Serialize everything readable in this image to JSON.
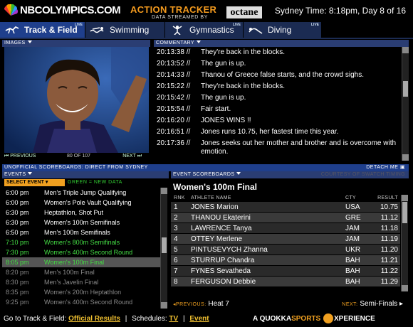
{
  "header": {
    "site": "NBCOLYMPICS.COM",
    "action_title": "ACTION TRACKER",
    "streamed": "DATA STREAMED BY",
    "octane": "octane",
    "sydney_time": "Sydney Time: 8:18pm, Day 8 of 16"
  },
  "tabs": [
    {
      "label": "Track & Field",
      "icon": "runner-icon",
      "active": true
    },
    {
      "label": "Swimming",
      "icon": "swimmer-icon",
      "active": false
    },
    {
      "label": "Gymnastics",
      "icon": "gymnast-icon",
      "active": false
    },
    {
      "label": "Diving",
      "icon": "diver-icon",
      "active": false
    }
  ],
  "live_badge": "LIVE",
  "images": {
    "header": "IMAGES",
    "prev": "PREVIOUS",
    "count": "80 OF 107",
    "next": "NEXT"
  },
  "commentary": {
    "header": "COMMENTARY",
    "entries": [
      {
        "time": "20:13:38 //",
        "text": "They're back in the blocks."
      },
      {
        "time": "20:13:52 //",
        "text": "The gun is up."
      },
      {
        "time": "20:14:33 //",
        "text": "Thanou of Greece false starts, and the crowd sighs."
      },
      {
        "time": "20:15:22 //",
        "text": "They're back in the blocks."
      },
      {
        "time": "20:15:42 //",
        "text": "The gun is up."
      },
      {
        "time": "20:15:54 //",
        "text": "Fair start."
      },
      {
        "time": "20:16:20 //",
        "text": "JONES WINS !!"
      },
      {
        "time": "20:16:51 //",
        "text": "Jones runs 10.75, her fastest time this year."
      },
      {
        "time": "20:17:36 //",
        "text": "Jones seeks out her mother and brother and is overcome with emotion."
      }
    ]
  },
  "scoreboard_bar": {
    "title": "UNOFFICIAL SCOREBOARDS: DIRECT FROM SYDNEY",
    "detach": "DETACH ME"
  },
  "events": {
    "header": "EVENTS",
    "select_label": "SELECT EVENT",
    "green_note": "GREEN = NEW DATA",
    "rows": [
      {
        "time": "6:00 pm",
        "name": "Men's Triple Jump Qualifying",
        "state": "done"
      },
      {
        "time": "6:00 pm",
        "name": "Women's Pole Vault Qualifying",
        "state": "done"
      },
      {
        "time": "6:30 pm",
        "name": "Heptathlon, Shot Put",
        "state": "done"
      },
      {
        "time": "6:30 pm",
        "name": "Women's 100m Semifinals",
        "state": "done"
      },
      {
        "time": "6:50 pm",
        "name": "Men's 100m Semifinals",
        "state": "done"
      },
      {
        "time": "7:10 pm",
        "name": "Women's 800m Semifinals",
        "state": "live"
      },
      {
        "time": "7:30 pm",
        "name": "Women's 400m Second Round",
        "state": "live"
      },
      {
        "time": "8:05 pm",
        "name": "Women's 100m Final",
        "state": "sel"
      },
      {
        "time": "8:20 pm",
        "name": "Men's 100m Final",
        "state": "future"
      },
      {
        "time": "8:30 pm",
        "name": "Men's Javelin Final",
        "state": "future"
      },
      {
        "time": "8:35 pm",
        "name": "Women's 200m Heptathlon",
        "state": "future"
      },
      {
        "time": "9:25 pm",
        "name": "Women's 400m Second Round",
        "state": "future"
      }
    ]
  },
  "event_scoreboard": {
    "header": "EVENT SCOREBOARDS",
    "courtesy": "COURTESY OF SWATCH TIMING",
    "title": "Women's 100m Final",
    "columns": [
      "RNK",
      "ATHLETE NAME",
      "CTY",
      "RESULT"
    ],
    "rows": [
      {
        "rnk": "1",
        "athlete": "JONES Marion",
        "cty": "USA",
        "result": "10.75"
      },
      {
        "rnk": "2",
        "athlete": "THANOU Ekaterini",
        "cty": "GRE",
        "result": "11.12"
      },
      {
        "rnk": "3",
        "athlete": "LAWRENCE Tanya",
        "cty": "JAM",
        "result": "11.18"
      },
      {
        "rnk": "4",
        "athlete": "OTTEY Merlene",
        "cty": "JAM",
        "result": "11.19"
      },
      {
        "rnk": "5",
        "athlete": "PINTUSEVYCH Zhanna",
        "cty": "UKR",
        "result": "11.20"
      },
      {
        "rnk": "6",
        "athlete": "STURRUP Chandra",
        "cty": "BAH",
        "result": "11.21"
      },
      {
        "rnk": "7",
        "athlete": "FYNES Sevatheda",
        "cty": "BAH",
        "result": "11.22"
      },
      {
        "rnk": "8",
        "athlete": "FERGUSON Debbie",
        "cty": "BAH",
        "result": "11.29"
      }
    ],
    "prev_label": "PREVIOUS:",
    "prev_value": "Heat 7",
    "next_label": "NEXT:",
    "next_value": "Semi-Finals"
  },
  "footer": {
    "goto": "Go to Track & Field:",
    "official": "Official Results",
    "schedules": "Schedules:",
    "tv": "TV",
    "event": "Event",
    "brand_a": "A",
    "brand_q": "QUOKKA",
    "brand_s": "SPORTS",
    "brand_x": "XPERIENCE"
  },
  "colors": {
    "accent": "#f0a020",
    "nav_blue": "#1f3f8c",
    "new_data_green": "#4d4"
  }
}
